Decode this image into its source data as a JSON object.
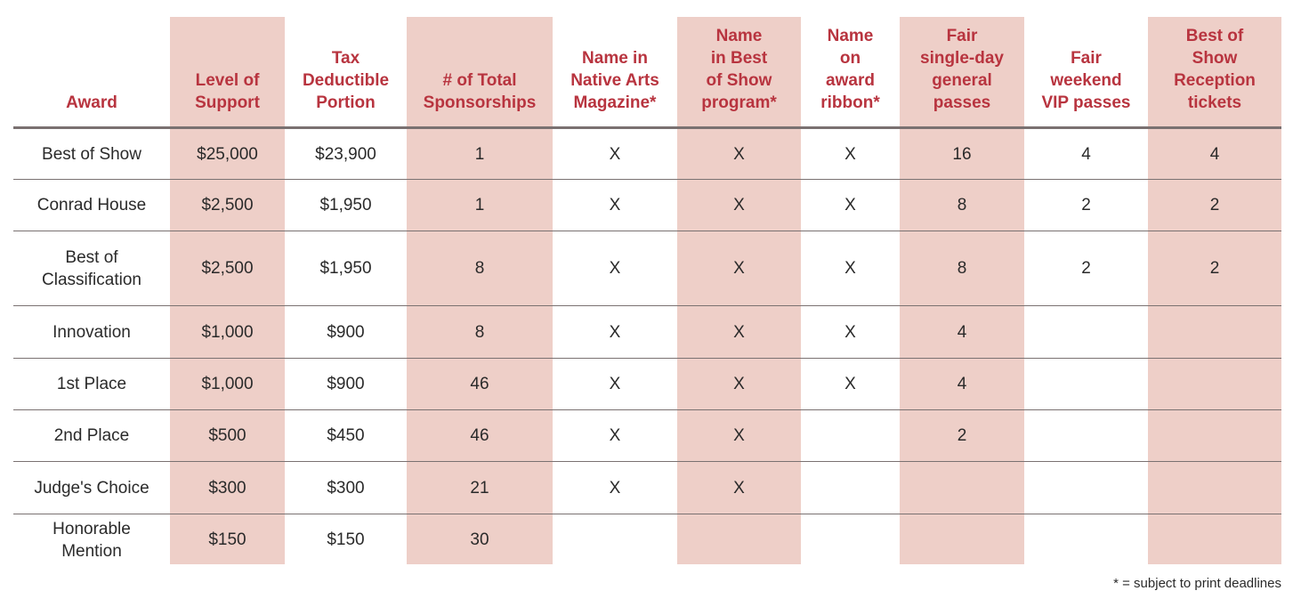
{
  "columns": [
    {
      "key": "award",
      "label": "Award",
      "shaded": false
    },
    {
      "key": "level",
      "label": "Level of Support",
      "shaded": true
    },
    {
      "key": "tax",
      "label": "Tax Deductible Portion",
      "shaded": false
    },
    {
      "key": "total",
      "label": "# of Total Sponsorships",
      "shaded": true
    },
    {
      "key": "magazine",
      "label": "Name in Native Arts Magazine*",
      "shaded": false
    },
    {
      "key": "program",
      "label": "Name in Best of Show program*",
      "shaded": true
    },
    {
      "key": "ribbon",
      "label": "Name on award ribbon*",
      "shaded": false
    },
    {
      "key": "general",
      "label": "Fair single-day general passes",
      "shaded": true
    },
    {
      "key": "vip",
      "label": "Fair weekend VIP passes",
      "shaded": false
    },
    {
      "key": "reception",
      "label": "Best of Show Reception tickets",
      "shaded": true
    }
  ],
  "header_lines": [
    [
      "Award"
    ],
    [
      "Level of",
      "Support"
    ],
    [
      "Tax",
      "Deductible",
      "Portion"
    ],
    [
      "# of Total",
      "Sponsorships"
    ],
    [
      "Name in",
      "Native Arts",
      "Magazine*"
    ],
    [
      "Name",
      "in Best",
      "of Show",
      "program*"
    ],
    [
      "Name",
      "on",
      "award",
      "ribbon*"
    ],
    [
      "Fair",
      "single-day",
      "general",
      "passes"
    ],
    [
      "Fair",
      "weekend",
      "VIP passes"
    ],
    [
      "Best of",
      "Show",
      "Reception",
      "tickets"
    ]
  ],
  "rows": [
    {
      "award": [
        "Best of Show"
      ],
      "cells": [
        "$25,000",
        "$23,900",
        "1",
        "X",
        "X",
        "X",
        "16",
        "4",
        "4"
      ]
    },
    {
      "award": [
        "Conrad House"
      ],
      "cells": [
        "$2,500",
        "$1,950",
        "1",
        "X",
        "X",
        "X",
        "8",
        "2",
        "2"
      ]
    },
    {
      "award": [
        "Best of",
        "Classification"
      ],
      "cells": [
        "$2,500",
        "$1,950",
        "8",
        "X",
        "X",
        "X",
        "8",
        "2",
        "2"
      ]
    },
    {
      "award": [
        "Innovation"
      ],
      "cells": [
        "$1,000",
        "$900",
        "8",
        "X",
        "X",
        "X",
        "4",
        "",
        ""
      ]
    },
    {
      "award": [
        "1st Place"
      ],
      "cells": [
        "$1,000",
        "$900",
        "46",
        "X",
        "X",
        "X",
        "4",
        "",
        ""
      ]
    },
    {
      "award": [
        "2nd Place"
      ],
      "cells": [
        "$500",
        "$450",
        "46",
        "X",
        "X",
        "",
        "2",
        "",
        ""
      ]
    },
    {
      "award": [
        "Judge's Choice"
      ],
      "cells": [
        "$300",
        "$300",
        "21",
        "X",
        "X",
        "",
        "",
        "",
        ""
      ]
    },
    {
      "award": [
        "Honorable",
        "Mention"
      ],
      "cells": [
        "$150",
        "$150",
        "30",
        "",
        "",
        "",
        "",
        "",
        ""
      ]
    }
  ],
  "footnote": "* = subject to print deadlines",
  "colors": {
    "header_text": "#b8343f",
    "shade": "#eecfc8",
    "rule": "#7a7171",
    "body_text": "#2a2a2a"
  }
}
